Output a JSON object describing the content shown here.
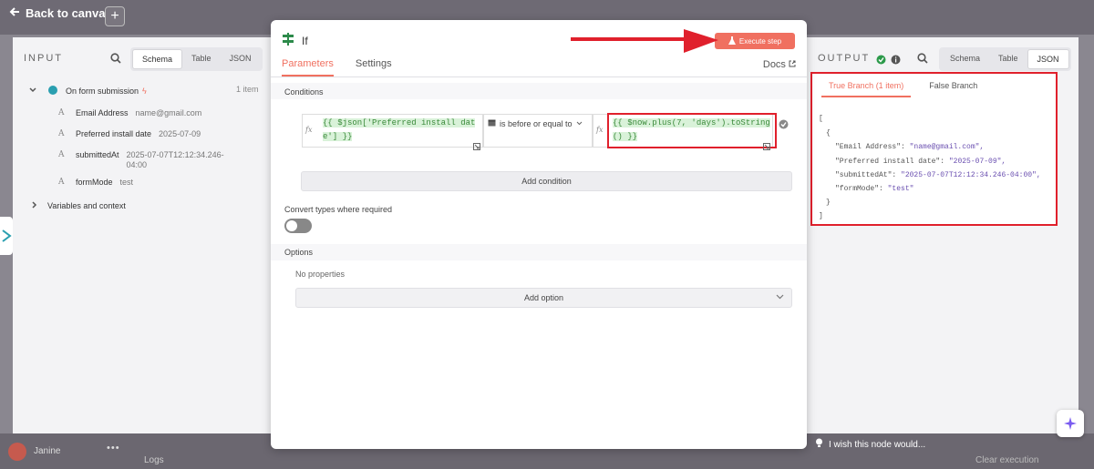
{
  "canvas": {
    "back_label": "Back to canvas",
    "plus": "+",
    "feedback": "I wish this node would...",
    "user_name": "Janine",
    "user_menu": "•••",
    "logs_label": "Logs",
    "clear_execution": "Clear execution"
  },
  "input": {
    "title": "INPUT",
    "views": [
      "Schema",
      "Table",
      "JSON"
    ],
    "active_view": "Schema",
    "trigger": {
      "label": "On form submission",
      "count": "1 item"
    },
    "fields": [
      {
        "type": "A",
        "name": "Email Address",
        "value": "name@gmail.com"
      },
      {
        "type": "A",
        "name": "Preferred install date",
        "value": "2025-07-09"
      },
      {
        "type": "A",
        "name": "submittedAt",
        "value": "2025-07-07T12:12:34.246-04:00"
      },
      {
        "type": "A",
        "name": "formMode",
        "value": "test"
      }
    ],
    "variables_label": "Variables and context"
  },
  "node": {
    "title": "If",
    "execute_label": "Execute step",
    "tabs": [
      "Parameters",
      "Settings"
    ],
    "active_tab": "Parameters",
    "docs_label": "Docs",
    "conditions_title": "Conditions",
    "condition": {
      "fx": "fx",
      "left_line1": "{{ $json['Preferred install dat",
      "left_line2": "e'] }}",
      "operator": "is before or equal to",
      "right_line1": "{{ $now.plus(7, 'days').toString",
      "right_line2": "() }}"
    },
    "add_condition_label": "Add condition",
    "convert_label": "Convert types where required",
    "convert_enabled": false,
    "options_title": "Options",
    "no_properties": "No properties",
    "add_option_label": "Add option"
  },
  "output": {
    "title": "OUTPUT",
    "views": [
      "Schema",
      "Table",
      "JSON"
    ],
    "active_view": "JSON",
    "branches": [
      "True Branch (1 item)",
      "False Branch"
    ],
    "active_branch": "True Branch (1 item)",
    "json": {
      "open_bracket": "[",
      "open_brace": "{",
      "rows": [
        {
          "key": "\"Email Address\":",
          "value": "\"name@gmail.com\","
        },
        {
          "key": "\"Preferred install date\":",
          "value": "\"2025-07-09\","
        },
        {
          "key": "\"submittedAt\":",
          "value": "\"2025-07-07T12:12:34.246-04:00\","
        },
        {
          "key": "\"formMode\":",
          "value": "\"test\""
        }
      ],
      "close_brace": "}",
      "close_bracket": "]"
    }
  },
  "colors": {
    "accent": "#f07060",
    "highlight_red": "#e0202c",
    "expr_green": "#3a8a3a",
    "json_value": "#6a4fb0"
  }
}
